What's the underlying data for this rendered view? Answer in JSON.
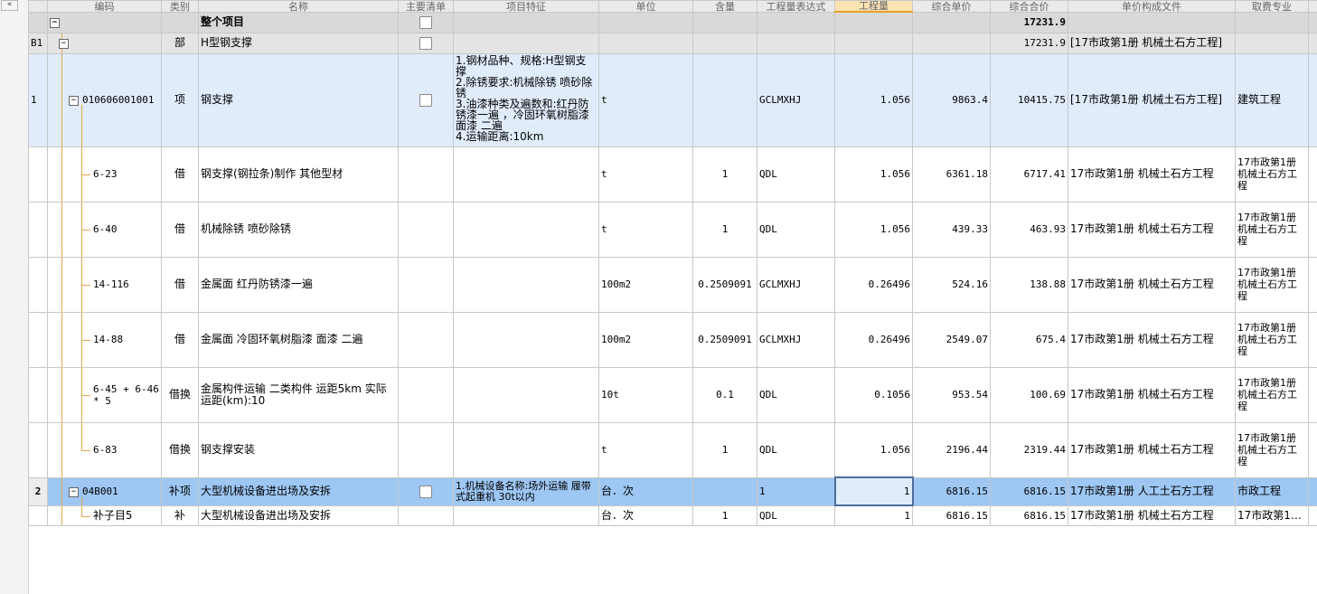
{
  "header": {
    "columns": [
      "编码",
      "类别",
      "名称",
      "主要清单",
      "项目特征",
      "单位",
      "含量",
      "工程量表达式",
      "工程量",
      "综合单价",
      "综合合价",
      "单价构成文件",
      "取费专业"
    ]
  },
  "total_row": {
    "name": "整个项目",
    "total": "17231.9"
  },
  "section_row": {
    "num": "B1",
    "type": "部",
    "name": "H型钢支撑",
    "total": "17231.9",
    "file": "[17市政第1册  机械土石方工程]"
  },
  "item_row": {
    "num": "1",
    "code": "010606001001",
    "type": "项",
    "name": "钢支撑",
    "features": "1.钢材品种、规格:H型钢支撑\n2.除锈要求:机械除锈 喷砂除锈\n3.油漆种类及遍数和:红丹防锈漆一遍 ，冷固环氧树脂漆面漆 二遍\n4.运输距离:10km",
    "unit": "t",
    "expr": "GCLMXHJ",
    "qty": "1.056",
    "price": "9863.4",
    "total": "10415.75",
    "file": "[17市政第1册  机械土石方工程]",
    "spec": "建筑工程"
  },
  "sub_rows": [
    {
      "code": "6-23",
      "type": "借",
      "name": "钢支撑(钢拉条)制作 其他型材",
      "unit": "t",
      "content": "1",
      "expr": "QDL",
      "qty": "1.056",
      "price": "6361.18",
      "total": "6717.41",
      "file": "17市政第1册  机械土石方工程",
      "spec": "17市政第1册 机械土石方工程"
    },
    {
      "code": "6-40",
      "type": "借",
      "name": "机械除锈 喷砂除锈",
      "unit": "t",
      "content": "1",
      "expr": "QDL",
      "qty": "1.056",
      "price": "439.33",
      "total": "463.93",
      "file": "17市政第1册  机械土石方工程",
      "spec": "17市政第1册 机械土石方工程"
    },
    {
      "code": "14-116",
      "type": "借",
      "name": "金属面 红丹防锈漆一遍",
      "unit": "100m2",
      "content": "0.2509091",
      "expr": "GCLMXHJ",
      "qty": "0.26496",
      "price": "524.16",
      "total": "138.88",
      "file": "17市政第1册  机械土石方工程",
      "spec": "17市政第1册 机械土石方工程"
    },
    {
      "code": "14-88",
      "type": "借",
      "name": "金属面 冷固环氧树脂漆 面漆 二遍",
      "unit": "100m2",
      "content": "0.2509091",
      "expr": "GCLMXHJ",
      "qty": "0.26496",
      "price": "2549.07",
      "total": "675.4",
      "file": "17市政第1册  机械土石方工程",
      "spec": "17市政第1册 机械土石方工程"
    },
    {
      "code": "6-45 + 6-46 * 5",
      "type": "借换",
      "name": "金属构件运输 二类构件 运距5km  实际运距(km):10",
      "unit": "10t",
      "content": "0.1",
      "expr": "QDL",
      "qty": "0.1056",
      "price": "953.54",
      "total": "100.69",
      "file": "17市政第1册  机械土石方工程",
      "spec": "17市政第1册 机械土石方工程"
    },
    {
      "code": "6-83",
      "type": "借换",
      "name": "钢支撑安装",
      "unit": "t",
      "content": "1",
      "expr": "QDL",
      "qty": "1.056",
      "price": "2196.44",
      "total": "2319.44",
      "file": "17市政第1册  机械土石方工程",
      "spec": "17市政第1册 机械土石方工程"
    }
  ],
  "selected_row": {
    "num": "2",
    "code": "04B001",
    "type": "补项",
    "name": "大型机械设备进出场及安拆",
    "features": "1.机械设备名称:场外运输 履带式起重机 30t以内",
    "unit": "台．次",
    "expr": "1",
    "qty": "1",
    "price": "6816.15",
    "total": "6816.15",
    "file": "17市政第1册  人工土石方工程",
    "spec": "市政工程"
  },
  "child_row": {
    "code": "补子目5",
    "type": "补",
    "name": "大型机械设备进出场及安拆",
    "unit": "台．次",
    "content": "1",
    "expr": "QDL",
    "qty": "1",
    "price": "6816.15",
    "total": "6816.15",
    "file": "17市政第1册  机械土石方工程",
    "spec": "17市政第1…"
  },
  "icons": {
    "collapse": "«",
    "expand_minus": "−"
  }
}
